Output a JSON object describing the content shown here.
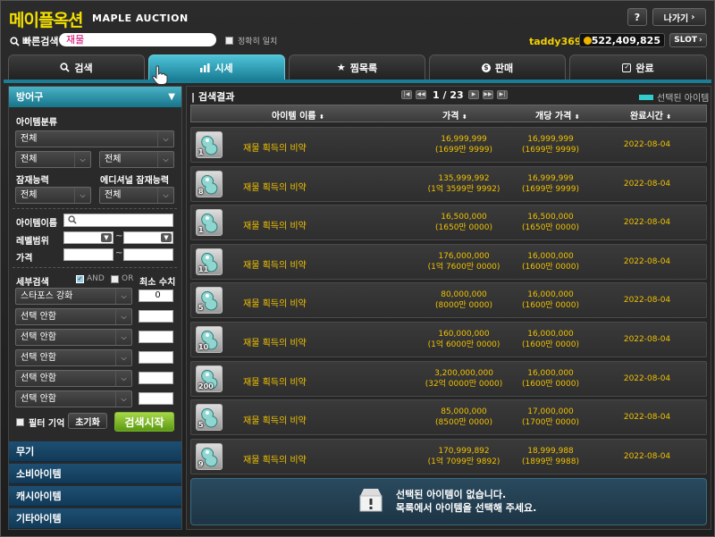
{
  "app": {
    "title_ko": "메이플옥션",
    "title_en": "MAPLE AUCTION",
    "help_label": "?",
    "exit_label": "나가기"
  },
  "quick_search": {
    "label": "빠른검색",
    "value": "재물",
    "exact_label": "정확히 일치"
  },
  "user": {
    "name": "taddy369",
    "meso": "522,409,825",
    "slot_label": "SLOT"
  },
  "tabs": [
    {
      "label": "검색",
      "icon": "search-icon"
    },
    {
      "label": "시세",
      "icon": "chart-icon",
      "active": true
    },
    {
      "label": "찜목록",
      "icon": "star-icon"
    },
    {
      "label": "판매",
      "icon": "sell-icon"
    },
    {
      "label": "완료",
      "icon": "check-icon"
    }
  ],
  "filter": {
    "category_title": "방어구",
    "item_class_label": "아이템분류",
    "class_value": "전체",
    "sub1_value": "전체",
    "sub2_value": "전체",
    "potential_label": "잠재능력",
    "additional_label": "에디셔널 잠재능력",
    "potential_value": "전체",
    "additional_value": "전체",
    "item_name_label": "아이템이름",
    "level_label": "레벨범위",
    "price_label": "가격",
    "range_sep": "~",
    "detail_label": "세부검색",
    "and_label": "AND",
    "or_label": "OR",
    "min_label": "최소 수치",
    "detail_rows": [
      {
        "option": "스타포스 강화",
        "value": "0"
      },
      {
        "option": "선택 안함",
        "value": ""
      },
      {
        "option": "선택 안함",
        "value": ""
      },
      {
        "option": "선택 안함",
        "value": ""
      },
      {
        "option": "선택 안함",
        "value": ""
      },
      {
        "option": "선택 안함",
        "value": ""
      }
    ],
    "remember_label": "필터 기억",
    "reset_label": "초기화",
    "search_label": "검색시작"
  },
  "categories": [
    "무기",
    "소비아이템",
    "캐시아이템",
    "기타아이템"
  ],
  "results": {
    "title": "검색결과",
    "page": "1 / 23",
    "selected_legend": "선택된 아이템",
    "headers": {
      "name": "아이템 이름",
      "price": "가격",
      "unit_price": "개당 가격",
      "date": "완료시간"
    },
    "rows": [
      {
        "qty": "1",
        "name": "재물 획득의 비약",
        "price": "16,999,999",
        "price_sub": "(1699만 9999)",
        "unit": "16,999,999",
        "unit_sub": "(1699만 9999)",
        "date": "2022-08-04"
      },
      {
        "qty": "8",
        "name": "재물 획득의 비약",
        "price": "135,999,992",
        "price_sub": "(1억 3599만 9992)",
        "unit": "16,999,999",
        "unit_sub": "(1699만 9999)",
        "date": "2022-08-04"
      },
      {
        "qty": "1",
        "name": "재물 획득의 비약",
        "price": "16,500,000",
        "price_sub": "(1650만 0000)",
        "unit": "16,500,000",
        "unit_sub": "(1650만 0000)",
        "date": "2022-08-04"
      },
      {
        "qty": "11",
        "name": "재물 획득의 비약",
        "price": "176,000,000",
        "price_sub": "(1억 7600만 0000)",
        "unit": "16,000,000",
        "unit_sub": "(1600만 0000)",
        "date": "2022-08-04"
      },
      {
        "qty": "5",
        "name": "재물 획득의 비약",
        "price": "80,000,000",
        "price_sub": "(8000만 0000)",
        "unit": "16,000,000",
        "unit_sub": "(1600만 0000)",
        "date": "2022-08-04"
      },
      {
        "qty": "10",
        "name": "재물 획득의 비약",
        "price": "160,000,000",
        "price_sub": "(1억 6000만 0000)",
        "unit": "16,000,000",
        "unit_sub": "(1600만 0000)",
        "date": "2022-08-04"
      },
      {
        "qty": "200",
        "name": "재물 획득의 비약",
        "price": "3,200,000,000",
        "price_sub": "(32억 0000만 0000)",
        "unit": "16,000,000",
        "unit_sub": "(1600만 0000)",
        "date": "2022-08-04"
      },
      {
        "qty": "5",
        "name": "재물 획득의 비약",
        "price": "85,000,000",
        "price_sub": "(8500만 0000)",
        "unit": "17,000,000",
        "unit_sub": "(1700만 0000)",
        "date": "2022-08-04"
      },
      {
        "qty": "9",
        "name": "재물 획득의 비약",
        "price": "170,999,892",
        "price_sub": "(1억 7099만 9892)",
        "unit": "18,999,988",
        "unit_sub": "(1899만 9988)",
        "date": "2022-08-04"
      }
    ],
    "empty_line1": "선택된 아이템이 없습니다.",
    "empty_line2": "목록에서 아이템을 선택해 주세요."
  },
  "colors": {
    "accent": "#1a7f96",
    "gold": "#f0c000",
    "title_yellow": "#f3e000"
  }
}
